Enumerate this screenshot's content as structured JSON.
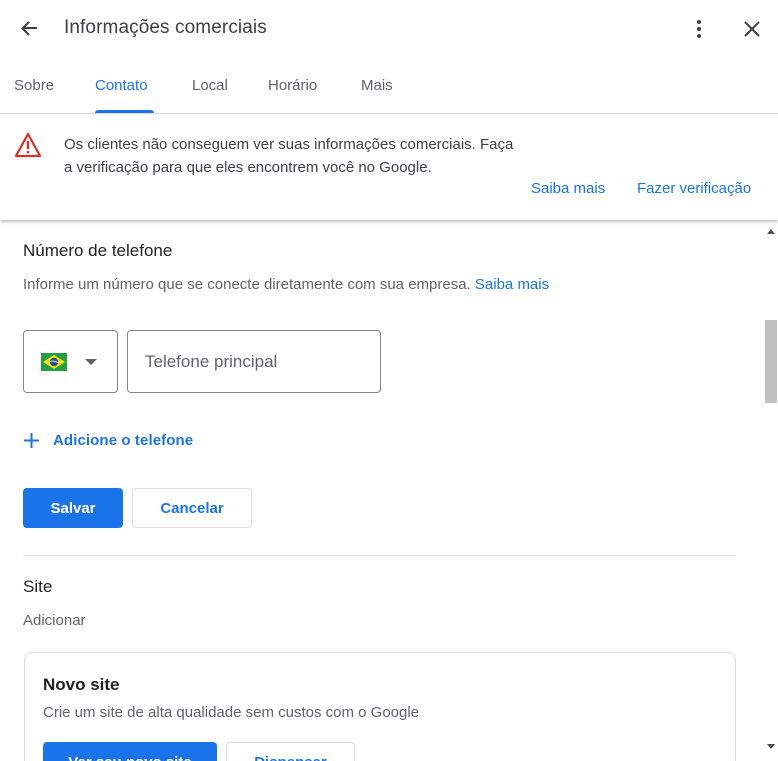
{
  "header": {
    "title": "Informações comerciais",
    "back_icon": "arrow-back-icon",
    "more_icon": "more-vert-icon",
    "close_icon": "close-icon"
  },
  "tabs": [
    {
      "label": "Sobre",
      "active": false
    },
    {
      "label": "Contato",
      "active": true
    },
    {
      "label": "Local",
      "active": false
    },
    {
      "label": "Horário",
      "active": false
    },
    {
      "label": "Mais",
      "active": false
    }
  ],
  "banner": {
    "icon": "warning-icon",
    "text": "Os clientes não conseguem ver suas informações comerciais. Faça a verificação para que eles encontrem você no Google.",
    "learn_more": "Saiba mais",
    "verify": "Fazer verificação"
  },
  "phone": {
    "title": "Número de telefone",
    "description": "Informe um número que se conecte diretamente com sua empresa.",
    "learn_more": "Saiba mais",
    "country_flag": "brazil-flag-icon",
    "input_placeholder": "Telefone principal",
    "input_value": "",
    "add_phone": "Adicione o telefone",
    "save": "Salvar",
    "cancel": "Cancelar"
  },
  "site": {
    "title": "Site",
    "value": "Adicionar",
    "card": {
      "title": "Novo site",
      "description": "Crie um site de alta qualidade sem custos com o Google",
      "primary_button": "Ver seu novo site",
      "secondary_button": "Dispensar"
    }
  },
  "colors": {
    "accent": "#1a73e8",
    "warning": "#d93025",
    "text": "#3c4043",
    "border": "#dadce0"
  }
}
